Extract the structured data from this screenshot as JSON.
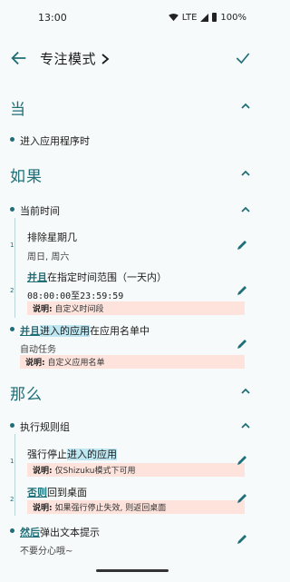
{
  "status": {
    "time": "13:00",
    "network": "LTE",
    "battery": "100%"
  },
  "header": {
    "title": "专注模式"
  },
  "when": {
    "title": "当",
    "trigger": "进入应用程序时"
  },
  "if": {
    "title": "如果",
    "group": "当前时间",
    "item1": {
      "title": "排除星期几",
      "value": "周日, 周六"
    },
    "item2": {
      "kw": "并且",
      "text": "在指定时间范围（一天内）",
      "value": "08:00:00至23:59:59",
      "note_label": "说明:",
      "note_text": "自定义时间段"
    },
    "item3": {
      "kw": "并且",
      "hl": "进入的应用",
      "text": "在应用名单中",
      "value": "自动任务",
      "note_label": "说明:",
      "note_text": "自定义应用名单"
    }
  },
  "then": {
    "title": "那么",
    "group": "执行规则组",
    "action1": {
      "text": "强行停止",
      "hl": "进入的应用",
      "note_label": "说明:",
      "note_text": "仅Shizuku模式下可用"
    },
    "action2": {
      "kw": "否则",
      "text": "回到桌面",
      "note_label": "说明:",
      "note_text": "如果强行停止失效, 则返回桌面"
    },
    "action3": {
      "kw": "然后",
      "text": "弹出文本提示",
      "value": "不要分心哦~"
    }
  },
  "numbers": {
    "n1": "1",
    "n2": "2"
  }
}
